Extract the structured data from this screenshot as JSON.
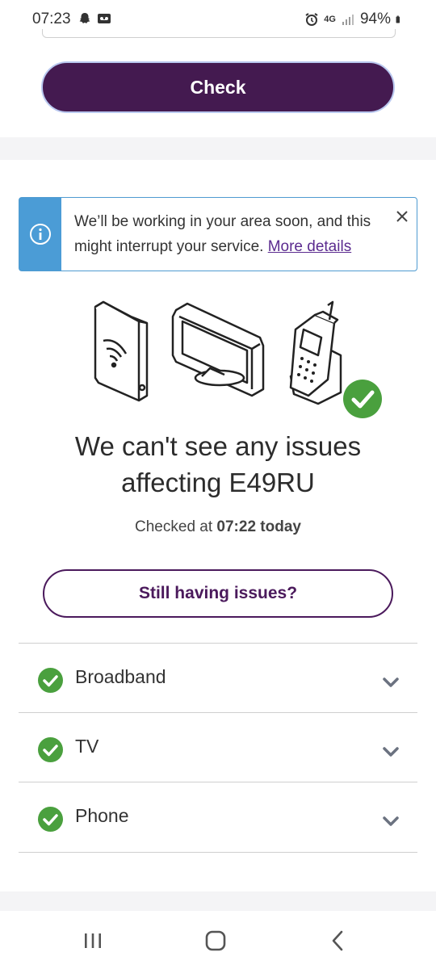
{
  "status_bar": {
    "time": "07:23",
    "network": "4G",
    "battery": "94%"
  },
  "check": {
    "button_label": "Check"
  },
  "notice": {
    "message": "We’ll be working in your area soon, and this might interrupt your service.",
    "link_label": "More details"
  },
  "result": {
    "headline": "We can't see any issues affecting E49RU",
    "checked_prefix": "Checked at",
    "checked_time": "07:22 today"
  },
  "issues_button_label": "Still having issues?",
  "services": [
    {
      "label": "Broadband"
    },
    {
      "label": "TV"
    },
    {
      "label": "Phone"
    }
  ],
  "colors": {
    "brand_purple": "#441a50",
    "info_blue": "#4b9cd6",
    "ok_green": "#4aa03e"
  }
}
